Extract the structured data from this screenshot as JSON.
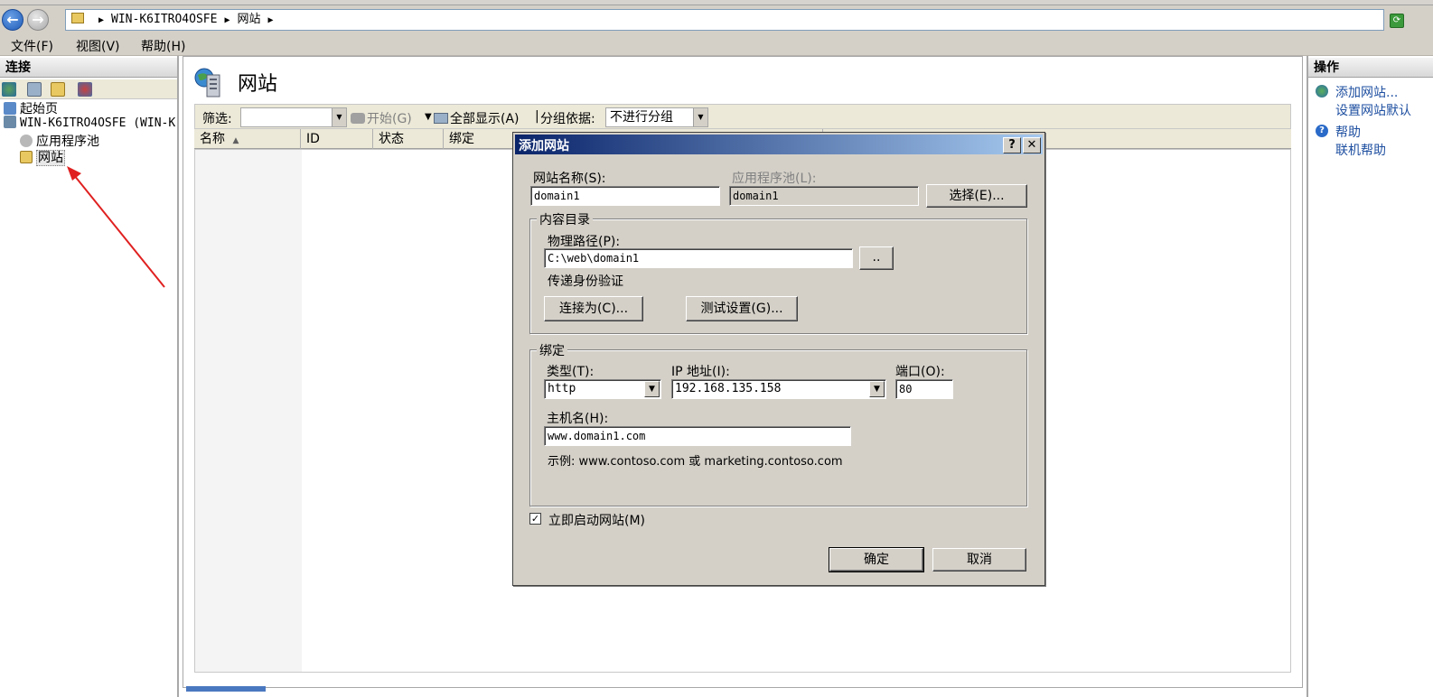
{
  "address": {
    "segments": [
      "WIN-K6ITRO4OSFE",
      "网站"
    ]
  },
  "menu": [
    "文件(F)",
    "视图(V)",
    "帮助(H)"
  ],
  "connections": {
    "title": "连接",
    "tree": {
      "start_page": "起始页",
      "server": "WIN-K6ITRO4OSFE (WIN-K",
      "app_pools": "应用程序池",
      "sites": "网站"
    }
  },
  "main": {
    "title": "网站",
    "filter_label": "筛选:",
    "filter_value": "",
    "start_label": "开始(G)",
    "show_all_label": "全部显示(A)",
    "group_by_label": "分组依据:",
    "group_by_value": "不进行分组",
    "columns": [
      "名称",
      "ID",
      "状态",
      "绑定"
    ]
  },
  "actions": {
    "title": "操作",
    "add_site": "添加网站...",
    "set_defaults": "设置网站默认",
    "help": "帮助",
    "online_help": "联机帮助"
  },
  "dialog": {
    "title": "添加网站",
    "help_btn": "?",
    "close_btn": "✕",
    "site_name_label": "网站名称(S):",
    "site_name_value": "domain1",
    "app_pool_label": "应用程序池(L):",
    "app_pool_value": "domain1",
    "select_btn": "选择(E)...",
    "content_dir_legend": "内容目录",
    "physical_path_label": "物理路径(P):",
    "physical_path_value": "C:\\web\\domain1",
    "browse_btn": "..",
    "pass_through_label": "传递身份验证",
    "connect_as_btn": "连接为(C)...",
    "test_settings_btn": "测试设置(G)...",
    "binding_legend": "绑定",
    "type_label": "类型(T):",
    "type_value": "http",
    "ip_label": "IP 地址(I):",
    "ip_value": "192.168.135.158",
    "port_label": "端口(O):",
    "port_value": "80",
    "hostname_label": "主机名(H):",
    "hostname_value": "www.domain1.com",
    "example_text": "示例: www.contoso.com 或 marketing.contoso.com",
    "start_now_label": "立即启动网站(M)",
    "start_now_checked": "✓",
    "ok_btn": "确定",
    "cancel_btn": "取消"
  },
  "colors": {
    "title_gradient_start": "#0a246a",
    "title_gradient_end": "#a6caf0",
    "link": "#1e4fa0",
    "annotation_arrow": "#e02020"
  }
}
